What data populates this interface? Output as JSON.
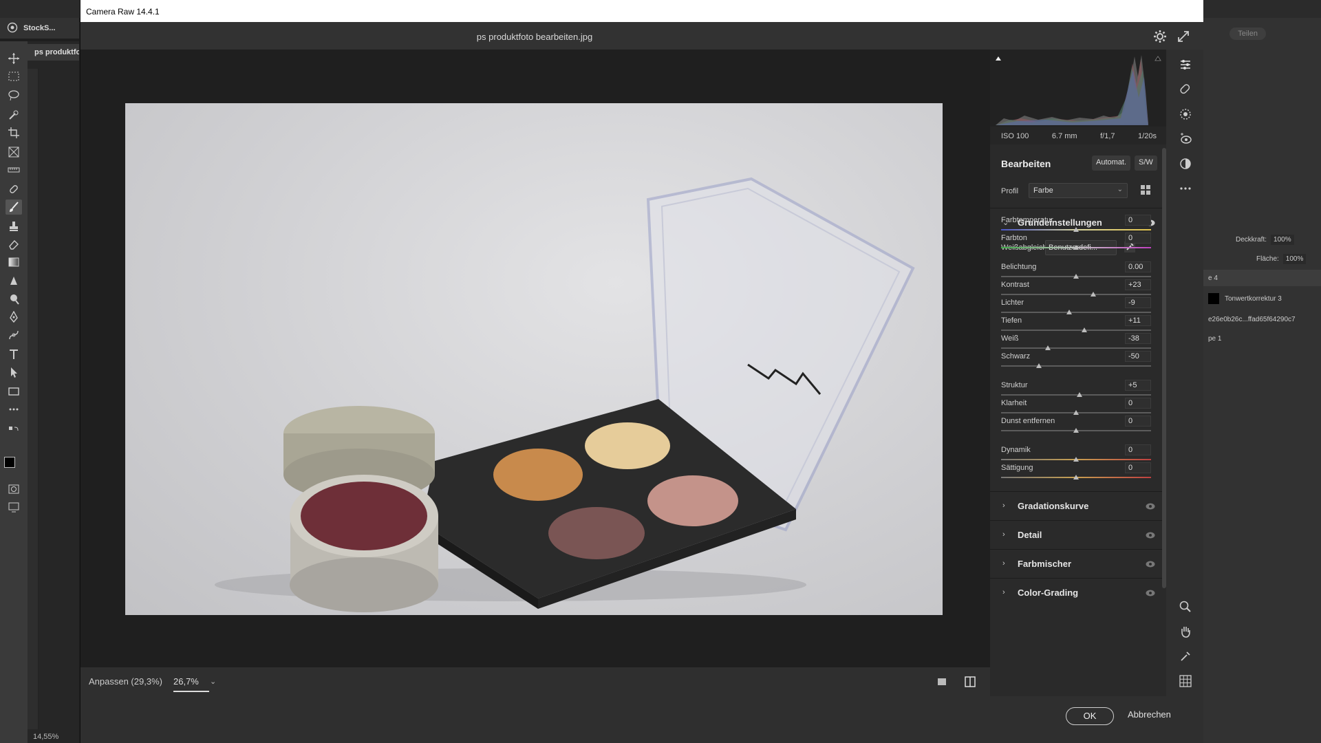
{
  "photoshop": {
    "home_label": "StockS...",
    "doc_tab": "ps produktfo",
    "zoom_status": "14,55%",
    "share_button": "Teilen",
    "layers": {
      "opacity_label": "Deckkraft:",
      "opacity_value": "100%",
      "fill_label": "Fläche:",
      "fill_value": "100%",
      "layer_group": "e 4",
      "layer_adjust": "Tonwertkorrektur 3",
      "layer_hash": "e26e0b26c...ffad65f64290c7",
      "layer_bg": "pe 1"
    }
  },
  "acr": {
    "window_title": "Camera Raw 14.4.1",
    "filename": "ps produktfoto bearbeiten.jpg",
    "bottom": {
      "fit_label": "Anpassen (29,3%)",
      "zoom": "26,7%"
    },
    "footer": {
      "ok": "OK",
      "cancel": "Abbrechen"
    },
    "exif": {
      "iso": "ISO 100",
      "focal": "6.7 mm",
      "aperture": "f/1,7",
      "shutter": "1/20s"
    },
    "edit": {
      "title": "Bearbeiten",
      "auto": "Automat.",
      "bw": "S/W",
      "profile_label": "Profil",
      "profile_value": "Farbe"
    },
    "basic": {
      "title": "Grundeinstellungen",
      "wb_label": "Weißabgleich",
      "wb_value": "Benutzerdefi...",
      "sliders": [
        {
          "label": "Farbtemperatur",
          "value": "0",
          "pos": 0.5
        },
        {
          "label": "Farbton",
          "value": "0",
          "pos": 0.5
        },
        {
          "label": "Belichtung",
          "value": "0.00",
          "pos": 0.5
        },
        {
          "label": "Kontrast",
          "value": "+23",
          "pos": 0.615
        },
        {
          "label": "Lichter",
          "value": "-9",
          "pos": 0.455
        },
        {
          "label": "Tiefen",
          "value": "+11",
          "pos": 0.555
        },
        {
          "label": "Weiß",
          "value": "-38",
          "pos": 0.31
        },
        {
          "label": "Schwarz",
          "value": "-50",
          "pos": 0.25
        },
        {
          "label": "Struktur",
          "value": "+5",
          "pos": 0.525
        },
        {
          "label": "Klarheit",
          "value": "0",
          "pos": 0.5
        },
        {
          "label": "Dunst entfernen",
          "value": "0",
          "pos": 0.5
        },
        {
          "label": "Dynamik",
          "value": "0",
          "pos": 0.5
        },
        {
          "label": "Sättigung",
          "value": "0",
          "pos": 0.5
        }
      ]
    },
    "sections": [
      {
        "title": "Gradationskurve"
      },
      {
        "title": "Detail"
      },
      {
        "title": "Farbmischer"
      },
      {
        "title": "Color-Grading"
      }
    ]
  }
}
